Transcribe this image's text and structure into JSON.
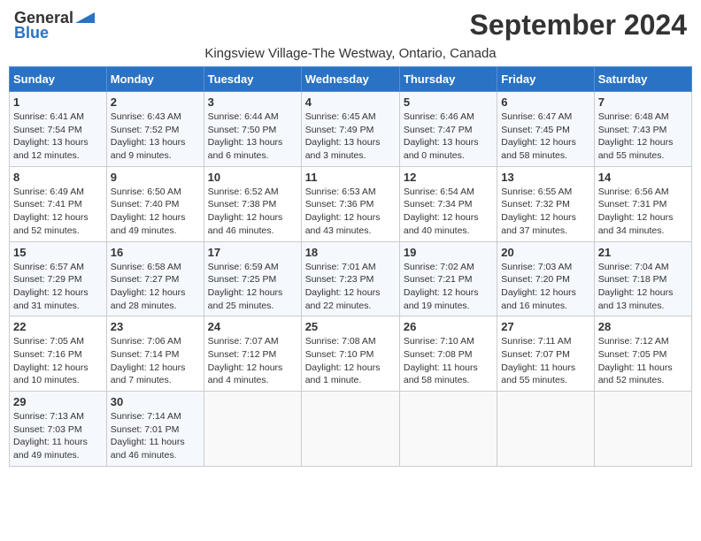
{
  "header": {
    "logo_general": "General",
    "logo_blue": "Blue",
    "main_title": "September 2024",
    "subtitle": "Kingsview Village-The Westway, Ontario, Canada"
  },
  "days_of_week": [
    "Sunday",
    "Monday",
    "Tuesday",
    "Wednesday",
    "Thursday",
    "Friday",
    "Saturday"
  ],
  "weeks": [
    [
      {
        "day": "1",
        "sunrise": "6:41 AM",
        "sunset": "7:54 PM",
        "daylight": "13 hours and 12 minutes."
      },
      {
        "day": "2",
        "sunrise": "6:43 AM",
        "sunset": "7:52 PM",
        "daylight": "13 hours and 9 minutes."
      },
      {
        "day": "3",
        "sunrise": "6:44 AM",
        "sunset": "7:50 PM",
        "daylight": "13 hours and 6 minutes."
      },
      {
        "day": "4",
        "sunrise": "6:45 AM",
        "sunset": "7:49 PM",
        "daylight": "13 hours and 3 minutes."
      },
      {
        "day": "5",
        "sunrise": "6:46 AM",
        "sunset": "7:47 PM",
        "daylight": "13 hours and 0 minutes."
      },
      {
        "day": "6",
        "sunrise": "6:47 AM",
        "sunset": "7:45 PM",
        "daylight": "12 hours and 58 minutes."
      },
      {
        "day": "7",
        "sunrise": "6:48 AM",
        "sunset": "7:43 PM",
        "daylight": "12 hours and 55 minutes."
      }
    ],
    [
      {
        "day": "8",
        "sunrise": "6:49 AM",
        "sunset": "7:41 PM",
        "daylight": "12 hours and 52 minutes."
      },
      {
        "day": "9",
        "sunrise": "6:50 AM",
        "sunset": "7:40 PM",
        "daylight": "12 hours and 49 minutes."
      },
      {
        "day": "10",
        "sunrise": "6:52 AM",
        "sunset": "7:38 PM",
        "daylight": "12 hours and 46 minutes."
      },
      {
        "day": "11",
        "sunrise": "6:53 AM",
        "sunset": "7:36 PM",
        "daylight": "12 hours and 43 minutes."
      },
      {
        "day": "12",
        "sunrise": "6:54 AM",
        "sunset": "7:34 PM",
        "daylight": "12 hours and 40 minutes."
      },
      {
        "day": "13",
        "sunrise": "6:55 AM",
        "sunset": "7:32 PM",
        "daylight": "12 hours and 37 minutes."
      },
      {
        "day": "14",
        "sunrise": "6:56 AM",
        "sunset": "7:31 PM",
        "daylight": "12 hours and 34 minutes."
      }
    ],
    [
      {
        "day": "15",
        "sunrise": "6:57 AM",
        "sunset": "7:29 PM",
        "daylight": "12 hours and 31 minutes."
      },
      {
        "day": "16",
        "sunrise": "6:58 AM",
        "sunset": "7:27 PM",
        "daylight": "12 hours and 28 minutes."
      },
      {
        "day": "17",
        "sunrise": "6:59 AM",
        "sunset": "7:25 PM",
        "daylight": "12 hours and 25 minutes."
      },
      {
        "day": "18",
        "sunrise": "7:01 AM",
        "sunset": "7:23 PM",
        "daylight": "12 hours and 22 minutes."
      },
      {
        "day": "19",
        "sunrise": "7:02 AM",
        "sunset": "7:21 PM",
        "daylight": "12 hours and 19 minutes."
      },
      {
        "day": "20",
        "sunrise": "7:03 AM",
        "sunset": "7:20 PM",
        "daylight": "12 hours and 16 minutes."
      },
      {
        "day": "21",
        "sunrise": "7:04 AM",
        "sunset": "7:18 PM",
        "daylight": "12 hours and 13 minutes."
      }
    ],
    [
      {
        "day": "22",
        "sunrise": "7:05 AM",
        "sunset": "7:16 PM",
        "daylight": "12 hours and 10 minutes."
      },
      {
        "day": "23",
        "sunrise": "7:06 AM",
        "sunset": "7:14 PM",
        "daylight": "12 hours and 7 minutes."
      },
      {
        "day": "24",
        "sunrise": "7:07 AM",
        "sunset": "7:12 PM",
        "daylight": "12 hours and 4 minutes."
      },
      {
        "day": "25",
        "sunrise": "7:08 AM",
        "sunset": "7:10 PM",
        "daylight": "12 hours and 1 minute."
      },
      {
        "day": "26",
        "sunrise": "7:10 AM",
        "sunset": "7:08 PM",
        "daylight": "11 hours and 58 minutes."
      },
      {
        "day": "27",
        "sunrise": "7:11 AM",
        "sunset": "7:07 PM",
        "daylight": "11 hours and 55 minutes."
      },
      {
        "day": "28",
        "sunrise": "7:12 AM",
        "sunset": "7:05 PM",
        "daylight": "11 hours and 52 minutes."
      }
    ],
    [
      {
        "day": "29",
        "sunrise": "7:13 AM",
        "sunset": "7:03 PM",
        "daylight": "11 hours and 49 minutes."
      },
      {
        "day": "30",
        "sunrise": "7:14 AM",
        "sunset": "7:01 PM",
        "daylight": "11 hours and 46 minutes."
      },
      null,
      null,
      null,
      null,
      null
    ]
  ],
  "labels": {
    "sunrise": "Sunrise:",
    "sunset": "Sunset:",
    "daylight": "Daylight:"
  }
}
